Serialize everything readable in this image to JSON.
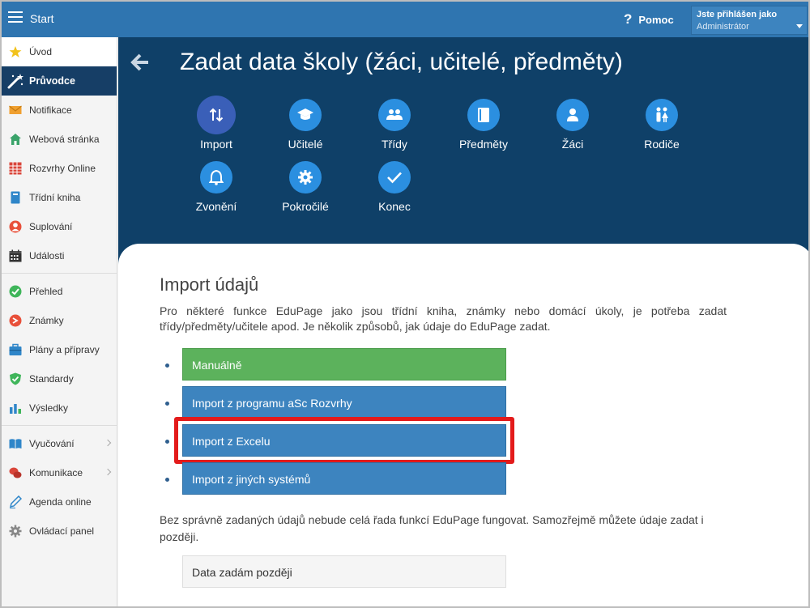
{
  "topbar": {
    "title": "Start",
    "help_label": "Pomoc",
    "user_label": "Jste přihlášen jako",
    "user_role": "Administrátor"
  },
  "sidebar": {
    "items": [
      {
        "label": "Úvod",
        "icon": "star-icon"
      },
      {
        "label": "Průvodce",
        "icon": "magic-wand-icon"
      },
      {
        "label": "Notifikace",
        "icon": "envelope-icon"
      },
      {
        "label": "Webová stránka",
        "icon": "house-icon"
      },
      {
        "label": "Rozvrhy Online",
        "icon": "timetable-icon"
      },
      {
        "label": "Třídní kniha",
        "icon": "book-icon"
      },
      {
        "label": "Suplování",
        "icon": "substitution-icon"
      },
      {
        "label": "Události",
        "icon": "calendar-icon"
      },
      {
        "label": "Přehled",
        "icon": "check-circle-icon"
      },
      {
        "label": "Známky",
        "icon": "grades-icon"
      },
      {
        "label": "Plány a přípravy",
        "icon": "briefcase-icon"
      },
      {
        "label": "Standardy",
        "icon": "shield-check-icon"
      },
      {
        "label": "Výsledky",
        "icon": "bar-chart-icon"
      },
      {
        "label": "Vyučování",
        "icon": "open-book-icon"
      },
      {
        "label": "Komunikace",
        "icon": "chat-bubbles-icon"
      },
      {
        "label": "Agenda online",
        "icon": "pen-icon"
      },
      {
        "label": "Ovládací panel",
        "icon": "gear-icon"
      }
    ]
  },
  "main": {
    "title": "Zadat data školy (žáci, učitelé, předměty)",
    "steps": [
      {
        "label": "Import",
        "icon": "import-arrows-icon"
      },
      {
        "label": "Učitelé",
        "icon": "graduation-cap-icon"
      },
      {
        "label": "Třídy",
        "icon": "people-icon"
      },
      {
        "label": "Předměty",
        "icon": "notebook-icon"
      },
      {
        "label": "Žáci",
        "icon": "person-icon"
      },
      {
        "label": "Rodiče",
        "icon": "parents-icon"
      },
      {
        "label": "Zvonění",
        "icon": "bell-icon"
      },
      {
        "label": "Pokročilé",
        "icon": "gear-icon"
      },
      {
        "label": "Konec",
        "icon": "checkmark-icon"
      }
    ],
    "card": {
      "title": "Import údajů",
      "intro": "Pro některé funkce EduPage jako jsou třídní kniha, známky nebo domácí úkoly, je potřeba zadat třídy/předměty/učitele apod. Je několik způsobů, jak údaje do EduPage zadat.",
      "options": [
        {
          "label": "Manuálně"
        },
        {
          "label": "Import z programu aSc Rozvrhy"
        },
        {
          "label": "Import z Excelu"
        },
        {
          "label": "Import z jiných systémů"
        }
      ],
      "note": "Bez správně zadaných údajů nebude celá řada funkcí EduPage fungovat. Samozřejmě můžete údaje zadat i později.",
      "later_button": "Data zadám později"
    }
  },
  "colors": {
    "topbar": "#2f75b0",
    "header_bg": "#0f4068",
    "step_circle": "#2b8fe0",
    "current_step": "#3a5fb8",
    "green_button": "#5cb25c",
    "blue_button": "#3d84bf",
    "highlight": "#e31b1b"
  }
}
